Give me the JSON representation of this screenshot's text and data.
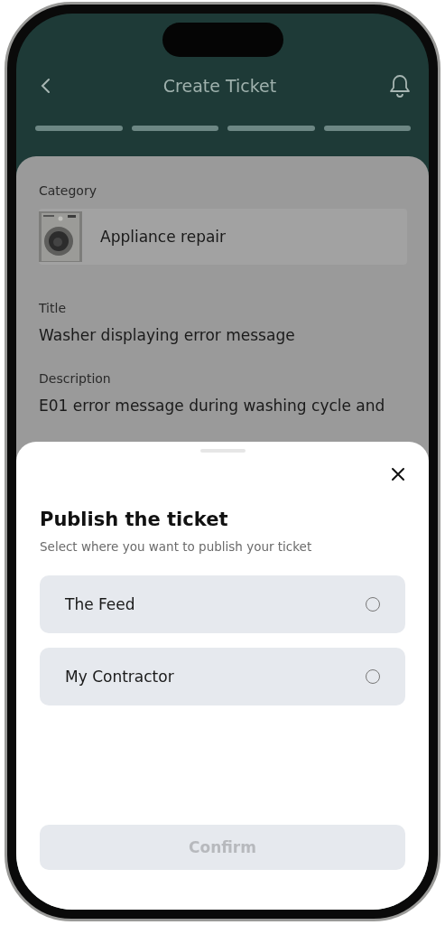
{
  "header": {
    "title": "Create Ticket"
  },
  "form": {
    "fields": [
      {
        "kind": "category",
        "label": "Category",
        "value": "Appliance repair"
      },
      {
        "kind": "text",
        "label": "Title",
        "value": "Washer displaying error message"
      },
      {
        "kind": "text",
        "label": "Description",
        "value": "E01 error message during washing cycle and"
      }
    ]
  },
  "sheet": {
    "title": "Publish the ticket",
    "subtitle": "Select where you want to publish your ticket",
    "options": [
      {
        "label": "The Feed",
        "selected": false
      },
      {
        "label": "My Contractor",
        "selected": false
      }
    ],
    "confirm": {
      "label": "Confirm",
      "disabled": true
    }
  }
}
